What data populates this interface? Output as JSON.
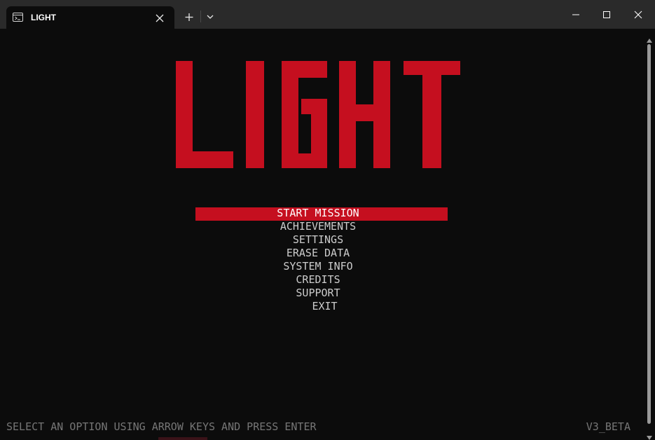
{
  "window": {
    "tab_title": "LIGHT",
    "tab_icon": "terminal-icon",
    "accent_color": "#c50f1f"
  },
  "game": {
    "logo_text": "LIGHT",
    "logo_color": "#c50f1f",
    "menu_items": [
      {
        "label": "START MISSION",
        "selected": true
      },
      {
        "label": "ACHIEVEMENTS",
        "selected": false
      },
      {
        "label": "SETTINGS",
        "selected": false
      },
      {
        "label": "ERASE DATA",
        "selected": false
      },
      {
        "label": "SYSTEM INFO",
        "selected": false
      },
      {
        "label": "CREDITS",
        "selected": false
      },
      {
        "label": "SUPPORT",
        "selected": false
      },
      {
        "label": "EXIT",
        "selected": false
      }
    ],
    "hint": "SELECT AN OPTION USING ARROW KEYS AND PRESS ENTER",
    "version": "V3_BETA"
  }
}
